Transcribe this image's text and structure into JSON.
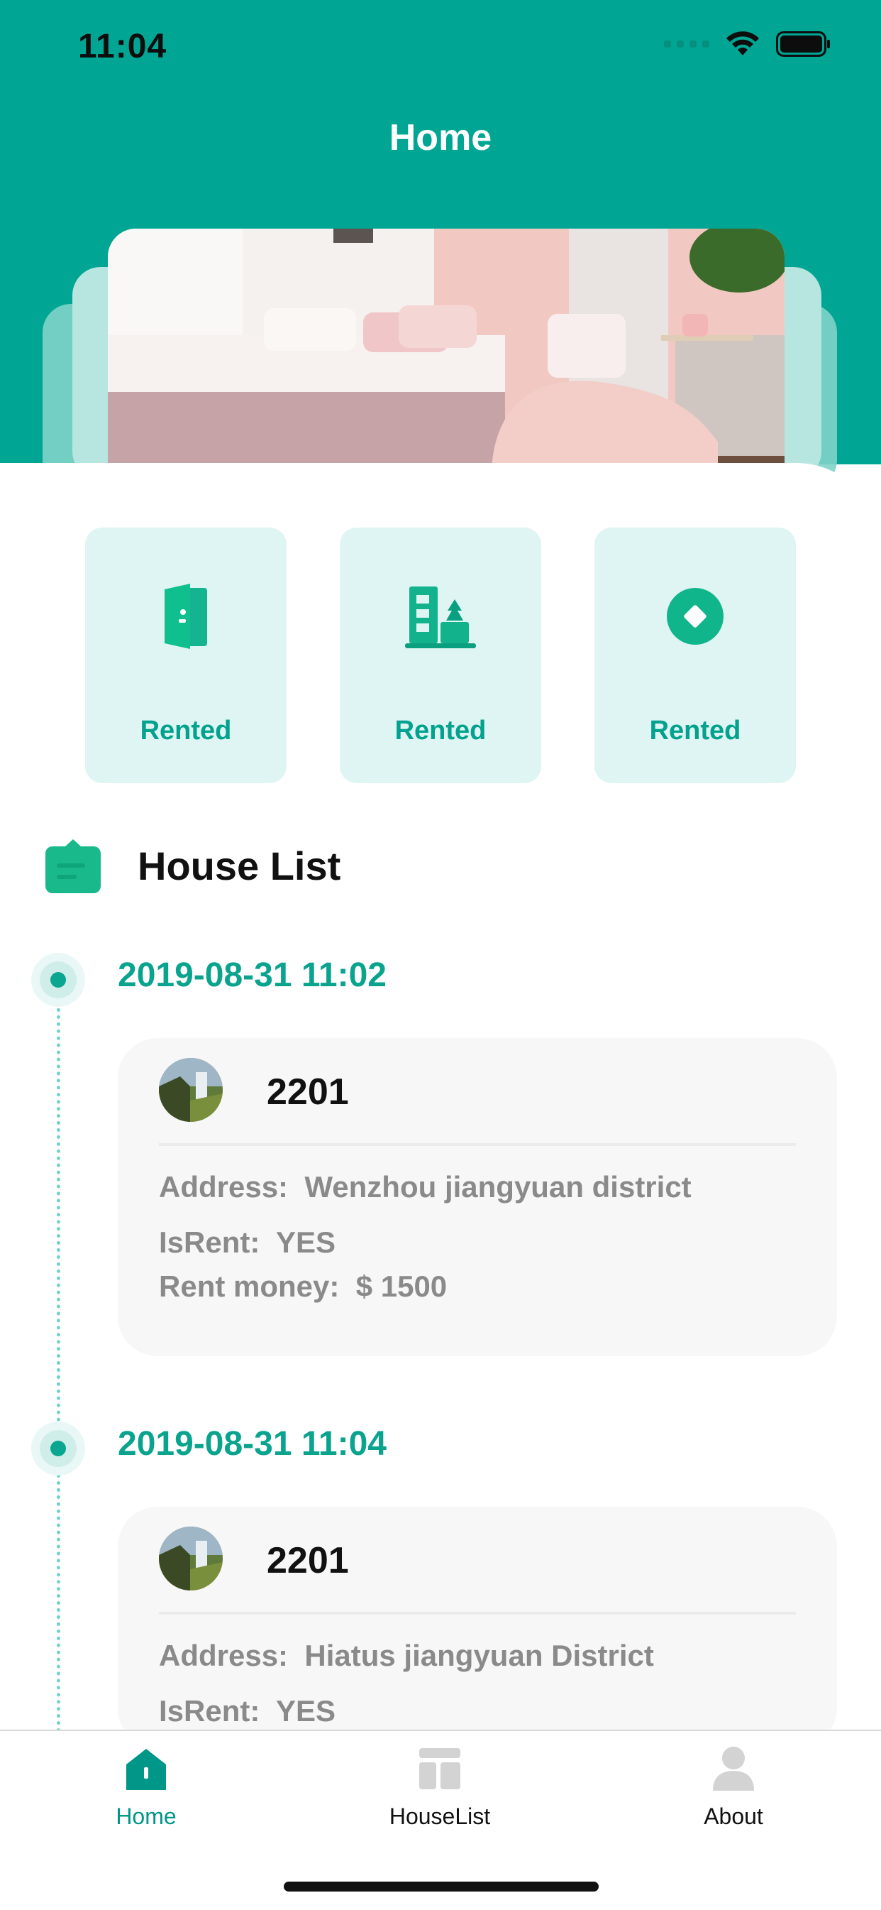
{
  "status": {
    "time": "11:04",
    "icons": [
      "signal-dots-icon",
      "wifi-icon",
      "battery-icon"
    ]
  },
  "header": {
    "title": "Home",
    "brand_color": "#00A693"
  },
  "stats": [
    {
      "label": "Rented",
      "icon": "door-icon"
    },
    {
      "label": "Rented",
      "icon": "building-icon"
    },
    {
      "label": "Rented",
      "icon": "diamond-circle-icon"
    }
  ],
  "section": {
    "title": "House List",
    "icon": "bag-icon"
  },
  "timeline": [
    {
      "date": "2019-08-31  11:02",
      "room": "2201",
      "address_label": "Address:",
      "address": "Wenzhou jiangyuan district",
      "isrent_label": "IsRent:",
      "isrent": "YES",
      "money_label": "Rent money:",
      "money": "$ 1500"
    },
    {
      "date": "2019-08-31  11:04",
      "room": "2201",
      "address_label": "Address:",
      "address": "Hiatus jiangyuan District",
      "isrent_label": "IsRent:",
      "isrent": "YES"
    }
  ],
  "tabs": [
    {
      "label": "Home",
      "icon": "home-icon",
      "active": true
    },
    {
      "label": "HouseList",
      "icon": "list-icon",
      "active": false
    },
    {
      "label": "About",
      "icon": "user-icon",
      "active": false
    }
  ],
  "colors": {
    "accent": "#00A693",
    "accent_text": "#0AA38E",
    "tile_bg": "#DFF5F3",
    "inactive_icon": "#D3D3D3"
  }
}
